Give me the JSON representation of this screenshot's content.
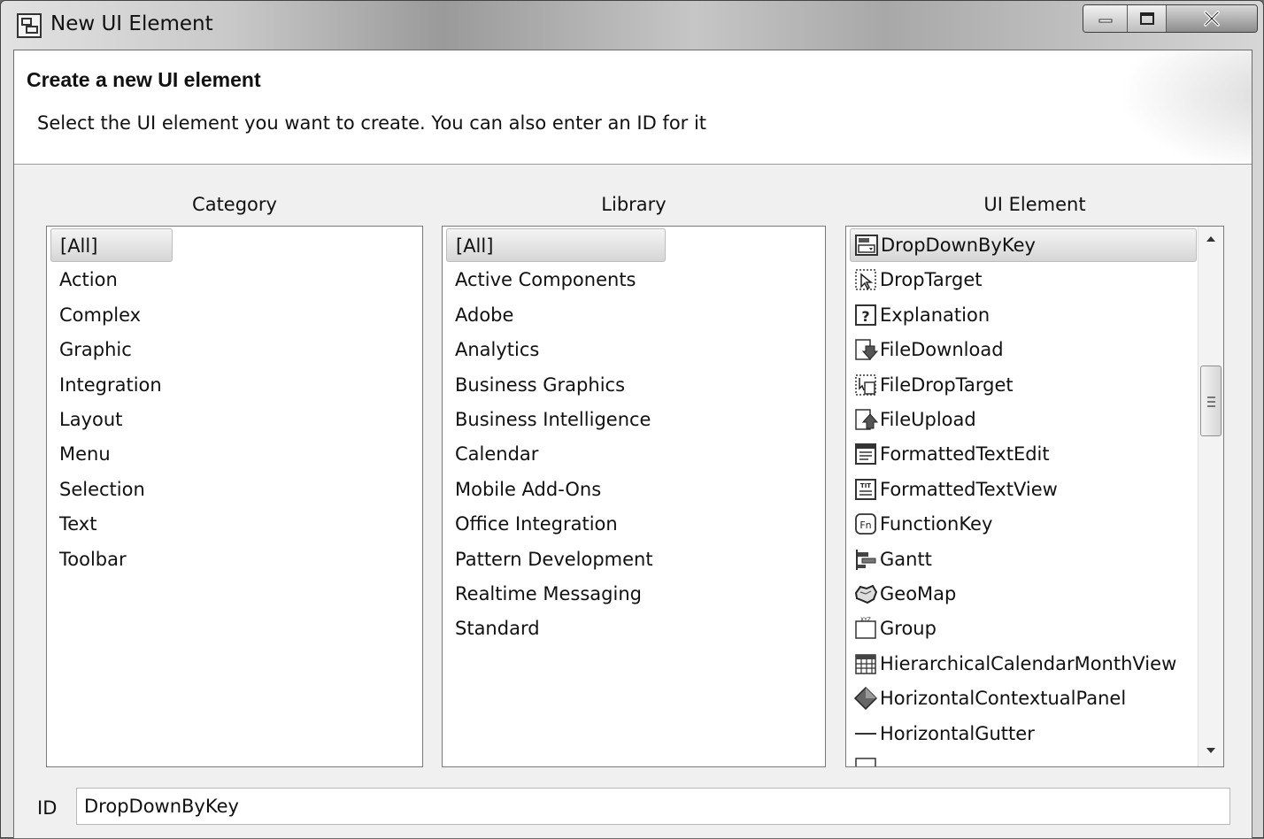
{
  "window": {
    "title": "New UI Element"
  },
  "header": {
    "title": "Create a new UI element",
    "description": "Select the UI element you want to create. You can also enter an ID for it"
  },
  "category": {
    "heading": "Category",
    "items": [
      "[All]",
      "Action",
      "Complex",
      "Graphic",
      "Integration",
      "Layout",
      "Menu",
      "Selection",
      "Text",
      "Toolbar"
    ],
    "selected": "[All]"
  },
  "library": {
    "heading": "Library",
    "items": [
      "[All]",
      "Active Components",
      "Adobe",
      "Analytics",
      "Business Graphics",
      "Business Intelligence",
      "Calendar",
      "Mobile Add-Ons",
      "Office Integration",
      "Pattern Development",
      "Realtime Messaging",
      "Standard"
    ],
    "selected": "[All]"
  },
  "ui_element": {
    "heading": "UI Element",
    "items": [
      {
        "label": "DropDownByKey",
        "icon": "dropdown-icon"
      },
      {
        "label": "DropTarget",
        "icon": "drop-target-icon"
      },
      {
        "label": "Explanation",
        "icon": "explanation-icon"
      },
      {
        "label": "FileDownload",
        "icon": "file-download-icon"
      },
      {
        "label": "FileDropTarget",
        "icon": "file-drop-target-icon"
      },
      {
        "label": "FileUpload",
        "icon": "file-upload-icon"
      },
      {
        "label": "FormattedTextEdit",
        "icon": "formatted-text-edit-icon"
      },
      {
        "label": "FormattedTextView",
        "icon": "formatted-text-view-icon"
      },
      {
        "label": "FunctionKey",
        "icon": "function-key-icon"
      },
      {
        "label": "Gantt",
        "icon": "gantt-icon"
      },
      {
        "label": "GeoMap",
        "icon": "geomap-icon"
      },
      {
        "label": "Group",
        "icon": "group-icon"
      },
      {
        "label": "HierarchicalCalendarMonthView",
        "icon": "calendar-icon"
      },
      {
        "label": "HorizontalContextualPanel",
        "icon": "contextual-panel-icon"
      },
      {
        "label": "HorizontalGutter",
        "icon": "gutter-icon"
      }
    ],
    "selected": "DropDownByKey"
  },
  "id_field": {
    "label": "ID",
    "value": "DropDownByKey"
  }
}
